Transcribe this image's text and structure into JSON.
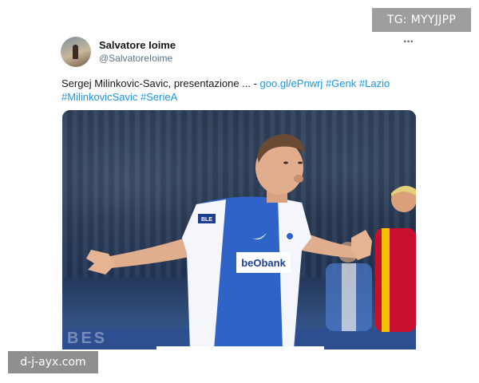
{
  "overlay": {
    "tg_label": "TG: MYYJJPP",
    "site_label": "d-j-ayx.com"
  },
  "tweet": {
    "author_name": "Salvatore Ioime",
    "author_handle": "@SalvatoreIoime",
    "more_icon": "more-dots-icon",
    "more_glyph": "···",
    "text_plain": "Sergej Milinkovic-Savic, presentazione ... - ",
    "link_url": "goo.gl/ePnwrj",
    "hashtags": [
      "#Genk",
      "#Lazio",
      "#MilinkovicSavic",
      "#SerieA"
    ]
  },
  "photo": {
    "sponsor_text": "beObank",
    "sleeve_badge": "BLE",
    "board_text": "BES"
  }
}
